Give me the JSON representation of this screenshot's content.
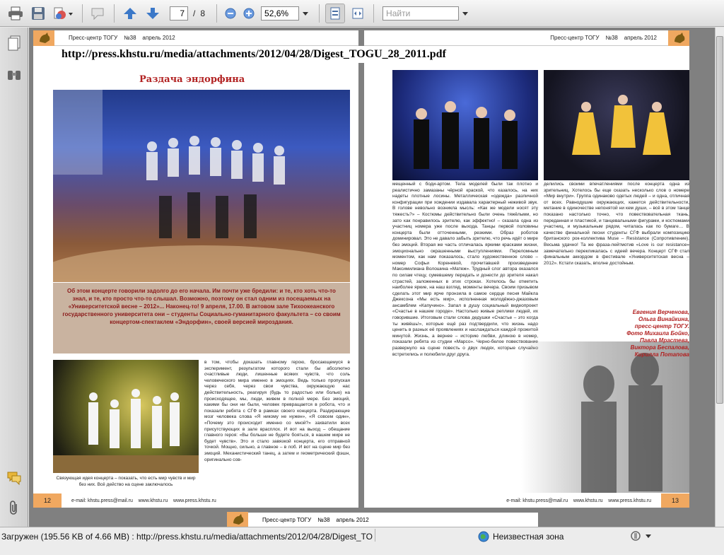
{
  "toolbar": {
    "page_current": "7",
    "page_separator": "/",
    "page_total": "8",
    "zoom": "52,6%",
    "search_placeholder": "Найти"
  },
  "document": {
    "url": "http://press.khstu.ru/media/attachments/2012/04/28/Digest_TOGU_28_2011.pdf",
    "header_left": "Пресс-центр ТОГУ    №38    апрель 2012",
    "header_right": "Пресс-центр ТОГУ    №38    апрель 2012",
    "article_title": "Раздача эндорфина",
    "lead": "Об этом концерте говорили задолго до его начала. Им почти уже бредили: и те, кто хоть что-то знал, и те, кто просто что-то слышал. Возможно, поэтому он стал одним из посещаемых на «Университетской весне – 2012»... Наконец-то! 9 апреля, 17.00. В актовом зале Тихоокеанского государственного университета они – студенты Социально-гуманитарного факультета – со своим концертом-спектаклем «Эндорфин», своей версией мироздания.",
    "photo_caption": "Связующая идея концерта – показать, что есть мир чувств и мир без них. Всё действо на сцене заключалось",
    "col1_text": "в том, чтобы доказать главному герою, бросающемуся в эксперимент, результатом которого стали бы абсолютно счастливые люди, лишенные всяких чувств, что соль человеческого мира именно в эмоциях. Ведь только пропуская через себя, через свои чувства, окружающую нас действительность, реагируя (будь то радостью или болью) на происходящее, мы, люди, живем в полной мере. Без эмоций, какими бы они ни были, человек превращается в робота, что и показали ребята с СГФ в рамках своего концерта. Раздирающие мозг человека слова «Я никому не нужен», «Я совсем один», «Почему это происходит именно со мной?» захватили всех присутствующих в зале врасплох. И вот на выход – обещание главного героя: «Вы больше не будете бояться, в нашем мире не будет чувств». Это и стало завязкой концерта, его отправной точкой. Мощно, сильно, а главное – в лоб. И вот на сцене мир без эмоций. Механистический танец, а затем и геометрический фэшн, оригинально сов-",
    "col2_text": "мещенный с боди-артом. Тела моделей были так плотно и реалистично замазаны чёрной краской, что казалось, на них надеты плотные лосины. Металлическая «одежда» различной конфигурации при хождении издавала характерный неживой звук. В голове невольно возникла мысль: «Как же модели носят эту тяжесть?» – Костюмы действительно были очень тяжёлыми, но зато как понравилось зрителю, как эффектно! – сказала одна из участниц номера уже после выхода. Танцы первой половины концерта были отточенными, резкими. Образ роботов доминировал. Это не давало забыть зрителю, что речь идёт о мире без эмоций. Вторая же часть отличалась яркими красками жизни, эмоционально окрашенными выступлениями. Переломным моментом, как нам показалось, стало художественное слово – номер Софьи Кореневой, прочитавшей произведение Максимилиана Волошина «Матеж». Трудный слог автора оказался по силам чтецу, сумевшему передать и донести до зрителя накал страстей, заложенных в этих строках. Хотелось бы отметить наиболее яркие, на наш взгляд, моменты вечера. Своим призывом сделать этот мир ярче пронзила в самое сердце песня Майкла Джексона «Мы есть мир», исполненная молодёжно-джазовым ансамблем «Капучино». Запал в душу социальный видеопроект «Счастье в нашем городе». Настолько живые реплики людей, их говорившие. Итоговым стали слова дедушки «Счастье – это когда ты живёшь!», которые ещё раз подтвердили, что жизнь надо ценить в разных её проявлениях и наслаждаться каждой прожитой минутой. Жизнь, а вернее – историю любви, длиною в номер, показали ребята из студии «Марсо». Черно-белое повествование развернуло на сцене повесть о двух людях, которые случайно встретились и полюбили друг друга.",
    "col3_text": "делились своими впечатлениями после концерта одна из зрительниц. Хотелось бы еще сказать несколько слов о номере «Мир внутри». Группа одинаково одетых людей – и одна, отличная от всех. Равнодушие окружающих, кажется действительности, метание в одиночестве непонятой ни кем души, – всё в этом танце показано настолько точно, что повествовательная ткань, переданная и пластикой, и танцевальными фигурами, и костюмами участниц, и музыкальным рядом, читалась как по бумаге… В качестве финальной песни студенты СГФ выбрали композицию британского рок-коллектива Muse – Resistance (Сопротивление). Весьма удачно! Та же фраза-лейтмотив «Love is our resistance» замечательно перекликалась с идеей вечера. Концерт СГФ стал финальным аккордом в фестивале «Университетская весна – 2012». Кстати сказать, вполне достойным.",
    "credits": [
      "Евгения Верченова,",
      "Ольга Винайкина,",
      "пресс-центр ТОГУ.",
      "Фото Михаила Бойко,",
      "Павла Мрастева,",
      "Виктора Беспалова,",
      "Кирилла Потапова"
    ],
    "footer_left_page": "12",
    "footer_left": "e-mail: khstu.press@mail.ru    www.khstu.ru    www.press.khstu.ru",
    "footer_right": "e-mail: khstu.press@mail.ru    www.khstu.ru    www.press.khstu.ru",
    "footer_right_page": "13",
    "next_header": "Пресс-центр ТОГУ    №38    апрель 2012"
  },
  "status": {
    "text": "Загружен (195.56 KB of 4.66 MB) : http://press.khstu.ru/media/attachments/2012/04/28/Digest_TOGU_28_2011.pdf",
    "zone": "Неизвестная зона"
  },
  "colors": {
    "accent_orange": "#f0a860",
    "title_red": "#b22222",
    "caption_bg": "#c9b3a0"
  }
}
